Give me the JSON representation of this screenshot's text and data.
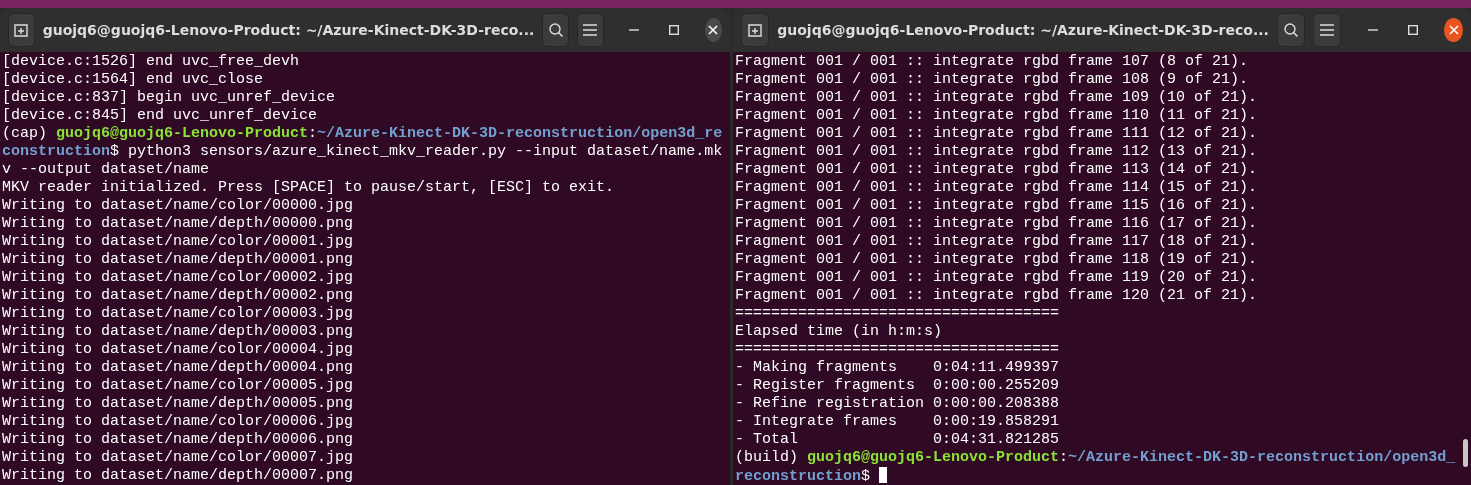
{
  "windows": [
    {
      "title": "guojq6@guojq6-Lenovo-Product: ~/Azure-Kinect-DK-3D-reco...",
      "active": false,
      "lines": [
        [
          {
            "kind": "text",
            "text": "[device.c:1526] end uvc_free_devh"
          }
        ],
        [
          {
            "kind": "text",
            "text": "[device.c:1564] end uvc_close"
          }
        ],
        [
          {
            "kind": "text",
            "text": "[device.c:837] begin uvc_unref_device"
          }
        ],
        [
          {
            "kind": "text",
            "text": "[device.c:845] end uvc_unref_device"
          }
        ],
        [
          {
            "kind": "text",
            "text": "(cap) "
          },
          {
            "kind": "user",
            "text": "guojq6@guojq6-Lenovo-Product"
          },
          {
            "kind": "text",
            "text": ":"
          },
          {
            "kind": "path",
            "text": "~/Azure-Kinect-DK-3D-reconstruction/open3d_re"
          }
        ],
        [
          {
            "kind": "path",
            "text": "construction"
          },
          {
            "kind": "text",
            "text": "$ python3 sensors/azure_kinect_mkv_reader.py --input dataset/name.mk"
          }
        ],
        [
          {
            "kind": "text",
            "text": "v --output dataset/name"
          }
        ],
        [
          {
            "kind": "text",
            "text": "MKV reader initialized. Press [SPACE] to pause/start, [ESC] to exit."
          }
        ],
        [
          {
            "kind": "text",
            "text": "Writing to dataset/name/color/00000.jpg"
          }
        ],
        [
          {
            "kind": "text",
            "text": "Writing to dataset/name/depth/00000.png"
          }
        ],
        [
          {
            "kind": "text",
            "text": "Writing to dataset/name/color/00001.jpg"
          }
        ],
        [
          {
            "kind": "text",
            "text": "Writing to dataset/name/depth/00001.png"
          }
        ],
        [
          {
            "kind": "text",
            "text": "Writing to dataset/name/color/00002.jpg"
          }
        ],
        [
          {
            "kind": "text",
            "text": "Writing to dataset/name/depth/00002.png"
          }
        ],
        [
          {
            "kind": "text",
            "text": "Writing to dataset/name/color/00003.jpg"
          }
        ],
        [
          {
            "kind": "text",
            "text": "Writing to dataset/name/depth/00003.png"
          }
        ],
        [
          {
            "kind": "text",
            "text": "Writing to dataset/name/color/00004.jpg"
          }
        ],
        [
          {
            "kind": "text",
            "text": "Writing to dataset/name/depth/00004.png"
          }
        ],
        [
          {
            "kind": "text",
            "text": "Writing to dataset/name/color/00005.jpg"
          }
        ],
        [
          {
            "kind": "text",
            "text": "Writing to dataset/name/depth/00005.png"
          }
        ],
        [
          {
            "kind": "text",
            "text": "Writing to dataset/name/color/00006.jpg"
          }
        ],
        [
          {
            "kind": "text",
            "text": "Writing to dataset/name/depth/00006.png"
          }
        ],
        [
          {
            "kind": "text",
            "text": "Writing to dataset/name/color/00007.jpg"
          }
        ],
        [
          {
            "kind": "text",
            "text": "Writing to dataset/name/depth/00007.png"
          }
        ]
      ]
    },
    {
      "title": "guojq6@guojq6-Lenovo-Product: ~/Azure-Kinect-DK-3D-reco...",
      "active": true,
      "lines": [
        [
          {
            "kind": "text",
            "text": "Fragment 001 / 001 :: integrate rgbd frame 107 (8 of 21)."
          }
        ],
        [
          {
            "kind": "text",
            "text": "Fragment 001 / 001 :: integrate rgbd frame 108 (9 of 21)."
          }
        ],
        [
          {
            "kind": "text",
            "text": "Fragment 001 / 001 :: integrate rgbd frame 109 (10 of 21)."
          }
        ],
        [
          {
            "kind": "text",
            "text": "Fragment 001 / 001 :: integrate rgbd frame 110 (11 of 21)."
          }
        ],
        [
          {
            "kind": "text",
            "text": "Fragment 001 / 001 :: integrate rgbd frame 111 (12 of 21)."
          }
        ],
        [
          {
            "kind": "text",
            "text": "Fragment 001 / 001 :: integrate rgbd frame 112 (13 of 21)."
          }
        ],
        [
          {
            "kind": "text",
            "text": "Fragment 001 / 001 :: integrate rgbd frame 113 (14 of 21)."
          }
        ],
        [
          {
            "kind": "text",
            "text": "Fragment 001 / 001 :: integrate rgbd frame 114 (15 of 21)."
          }
        ],
        [
          {
            "kind": "text",
            "text": "Fragment 001 / 001 :: integrate rgbd frame 115 (16 of 21)."
          }
        ],
        [
          {
            "kind": "text",
            "text": "Fragment 001 / 001 :: integrate rgbd frame 116 (17 of 21)."
          }
        ],
        [
          {
            "kind": "text",
            "text": "Fragment 001 / 001 :: integrate rgbd frame 117 (18 of 21)."
          }
        ],
        [
          {
            "kind": "text",
            "text": "Fragment 001 / 001 :: integrate rgbd frame 118 (19 of 21)."
          }
        ],
        [
          {
            "kind": "text",
            "text": "Fragment 001 / 001 :: integrate rgbd frame 119 (20 of 21)."
          }
        ],
        [
          {
            "kind": "text",
            "text": "Fragment 001 / 001 :: integrate rgbd frame 120 (21 of 21)."
          }
        ],
        [
          {
            "kind": "text",
            "text": "===================================="
          }
        ],
        [
          {
            "kind": "text",
            "text": "Elapsed time (in h:m:s)"
          }
        ],
        [
          {
            "kind": "text",
            "text": "===================================="
          }
        ],
        [
          {
            "kind": "text",
            "text": "- Making fragments    0:04:11.499397"
          }
        ],
        [
          {
            "kind": "text",
            "text": "- Register fragments  0:00:00.255209"
          }
        ],
        [
          {
            "kind": "text",
            "text": "- Refine registration 0:00:00.208388"
          }
        ],
        [
          {
            "kind": "text",
            "text": "- Integrate frames    0:00:19.858291"
          }
        ],
        [
          {
            "kind": "text",
            "text": "- Total               0:04:31.821285"
          }
        ],
        [
          {
            "kind": "text",
            "text": "(build) "
          },
          {
            "kind": "user",
            "text": "guojq6@guojq6-Lenovo-Product"
          },
          {
            "kind": "text",
            "text": ":"
          },
          {
            "kind": "path",
            "text": "~/Azure-Kinect-DK-3D-reconstruction/open3d_"
          }
        ],
        [
          {
            "kind": "path",
            "text": "reconstruction"
          },
          {
            "kind": "text",
            "text": "$ "
          },
          {
            "kind": "cursor"
          }
        ]
      ]
    }
  ]
}
